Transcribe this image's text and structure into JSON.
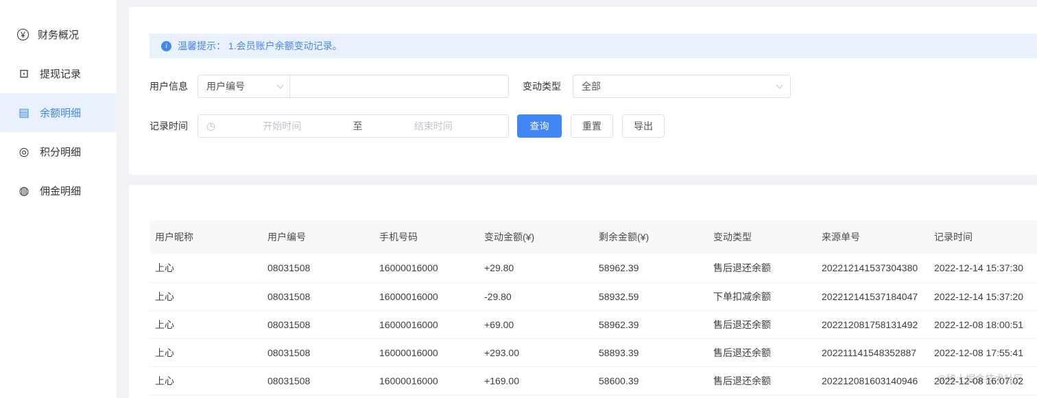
{
  "colors": {
    "primary": "#4086F4",
    "active_item_bg": "#E8F1FD",
    "alert_bg": "#E9F1FE"
  },
  "sidebar": {
    "items": [
      {
        "label": "财务概况",
        "icon": "¥",
        "active": false
      },
      {
        "label": "提现记录",
        "icon": "⊡",
        "active": false
      },
      {
        "label": "余额明细",
        "icon": "▤",
        "active": true
      },
      {
        "label": "积分明细",
        "icon": "◎",
        "active": false
      },
      {
        "label": "佣金明细",
        "icon": "◍",
        "active": false
      }
    ]
  },
  "alert": {
    "icon": "i",
    "text": "温馨提示：  1.会员账户余额变动记录。"
  },
  "filters": {
    "user_info_label": "用户信息",
    "user_field_selected": "用户编号",
    "user_input_value": "",
    "change_type_label": "变动类型",
    "change_type_selected": "全部",
    "record_time_label": "记录时间",
    "clock_icon": "◷",
    "start_placeholder": "开始时间",
    "to_label": "至",
    "end_placeholder": "结束时间",
    "search_button": "查询",
    "reset_button": "重置",
    "export_button": "导出"
  },
  "table": {
    "headers": [
      "用户昵称",
      "用户编号",
      "手机号码",
      "变动金额(¥)",
      "剩余金额(¥)",
      "变动类型",
      "来源单号",
      "记录时间"
    ],
    "rows": [
      [
        "上心",
        "08031508",
        "16000016000",
        "+29.80",
        "58962.39",
        "售后退还余额",
        "202212141537304380",
        "2022-12-14 15:37:30"
      ],
      [
        "上心",
        "08031508",
        "16000016000",
        "-29.80",
        "58932.59",
        "下单扣减余额",
        "202212141537184047",
        "2022-12-14 15:37:20"
      ],
      [
        "上心",
        "08031508",
        "16000016000",
        "+69.00",
        "58962.39",
        "售后退还余额",
        "202212081758131492",
        "2022-12-08 18:00:51"
      ],
      [
        "上心",
        "08031508",
        "16000016000",
        "+293.00",
        "58893.39",
        "售后退还余额",
        "202211141548352887",
        "2022-12-08 17:55:41"
      ],
      [
        "上心",
        "08031508",
        "16000016000",
        "+169.00",
        "58600.39",
        "售后退还余额",
        "202212081603140946",
        "2022-12-08 16:07:02"
      ]
    ]
  },
  "watermark": "@稀土掘金技术社区"
}
